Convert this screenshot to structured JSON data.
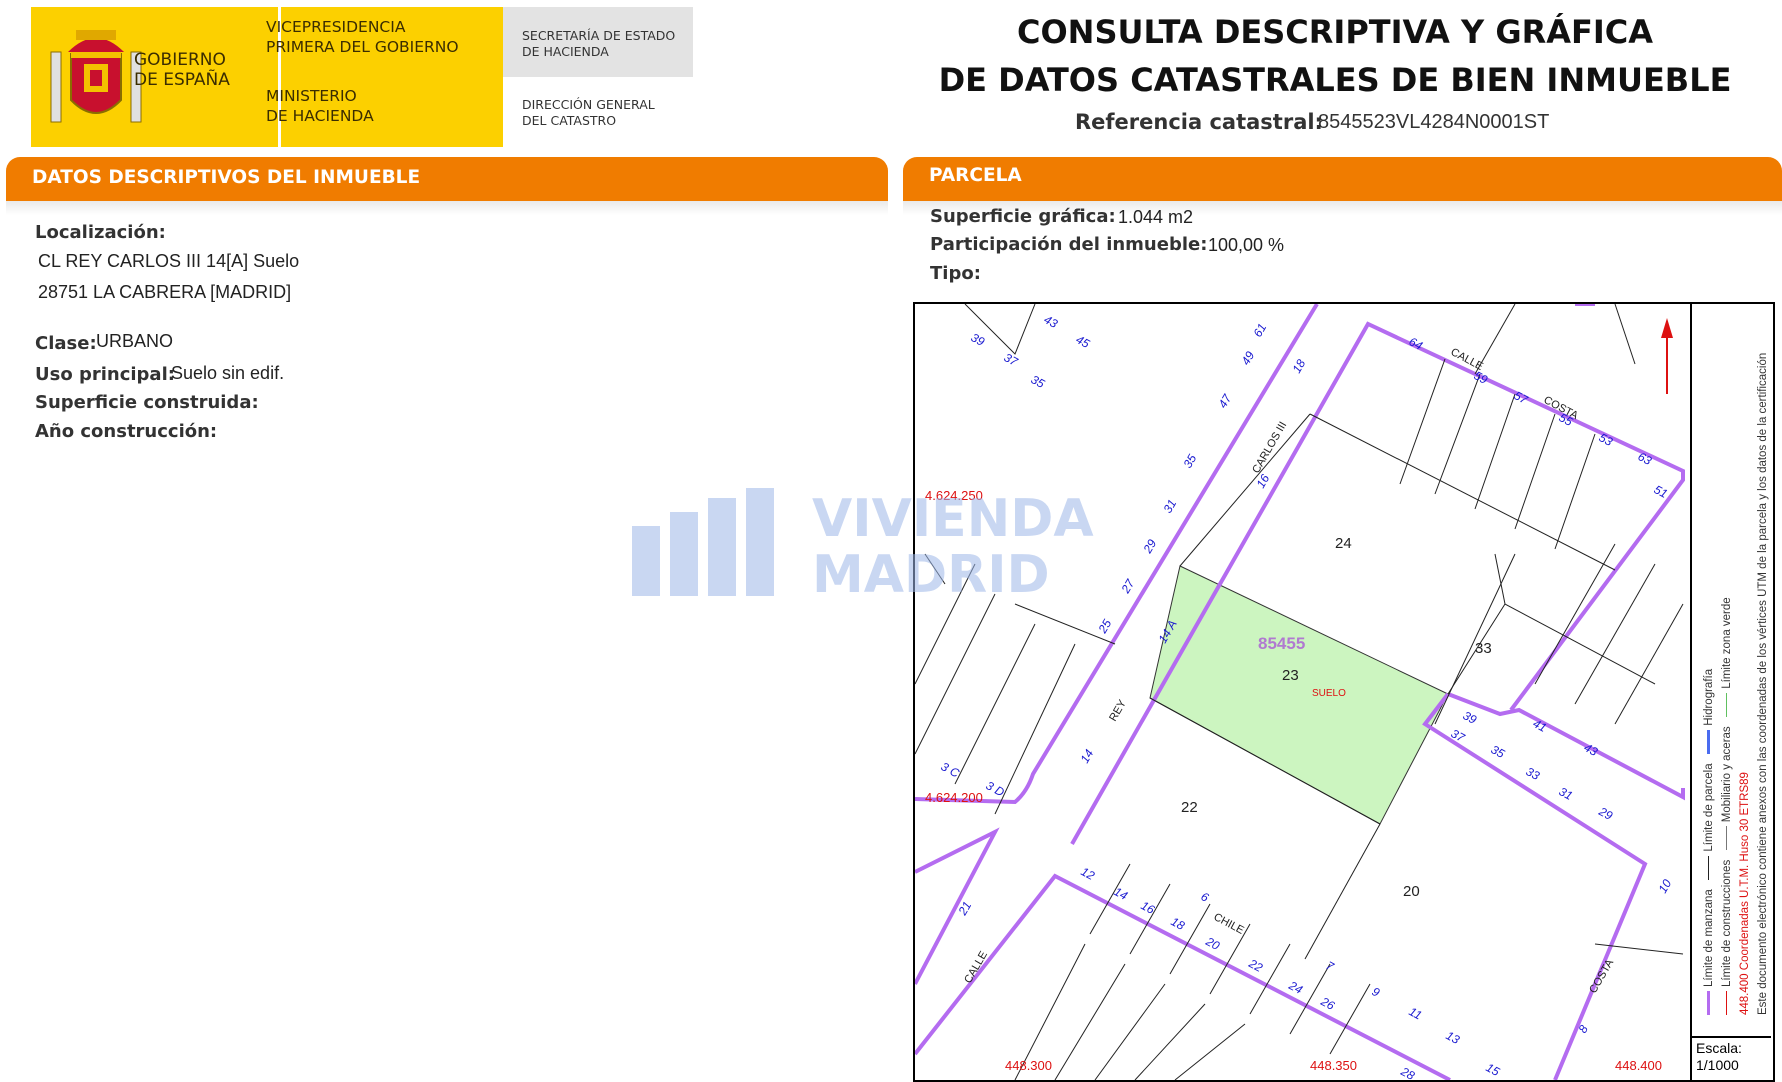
{
  "header": {
    "gobierno": [
      "GOBIERNO",
      "DE ESPAÑA"
    ],
    "vicepresidencia": [
      "VICEPRESIDENCIA",
      "PRIMERA DEL GOBIERNO"
    ],
    "ministerio": [
      "MINISTERIO",
      "DE HACIENDA"
    ],
    "secretaria": [
      "SECRETARÍA DE ESTADO",
      "DE HACIENDA"
    ],
    "direccion": [
      "DIRECCIÓN GENERAL",
      "DEL CATASTRO"
    ],
    "title_line1": "CONSULTA DESCRIPTIVA Y GRÁFICA",
    "title_line2": "DE DATOS CATASTRALES DE BIEN INMUEBLE",
    "ref_label": "Referencia catastral:",
    "ref_value": "8545523VL4284N0001ST"
  },
  "colors": {
    "brand_yellow": "#fcd000",
    "section_orange": "#f07c00",
    "parcel_green": "#ccf5c0",
    "boundary_purple": "#b46cf0",
    "street_number_blue": "#1a1ad0",
    "coordinate_red": "#d11"
  },
  "descriptivos": {
    "heading": "DATOS DESCRIPTIVOS DEL INMUEBLE",
    "localizacion_label": "Localización:",
    "address_line1": "CL REY CARLOS III 14[A] Suelo",
    "address_line2": "28751 LA CABRERA [MADRID]",
    "clase_label": "Clase:",
    "clase_value": "URBANO",
    "uso_label": "Uso principal:",
    "uso_value": "Suelo sin edif.",
    "superficie_label": "Superficie construida:",
    "anio_label": "Año construcción:"
  },
  "parcela": {
    "heading": "PARCELA",
    "superficie_label": "Superficie gráfica:",
    "superficie_value": "1.044 m2",
    "participacion_label": "Participación del inmueble:",
    "participacion_value": "100,00 %",
    "tipo_label": "Tipo:"
  },
  "map": {
    "coord_y_top": "4.624.250",
    "coord_y_bottom": "4.624.200",
    "coord_x": [
      "448.300",
      "448.350",
      "448.400"
    ],
    "parcel_ref": "85455",
    "parcel_labels": [
      "24",
      "33",
      "23",
      "22",
      "20"
    ],
    "suelo_label": "SUELO",
    "streets": [
      "CALLE",
      "COSTA",
      "CARLOS III",
      "REY",
      "CHILE",
      "COSTA",
      "CALLE"
    ],
    "street_numbers": [
      "39",
      "37",
      "35",
      "43",
      "45",
      "61",
      "49",
      "47",
      "35",
      "31",
      "29",
      "27",
      "25",
      "18",
      "16",
      "14 A",
      "14",
      "64",
      "59",
      "57",
      "55",
      "53",
      "63",
      "51",
      "39",
      "37",
      "35",
      "33",
      "31",
      "29",
      "41",
      "43",
      "12",
      "14",
      "16",
      "18",
      "20",
      "22",
      "24",
      "26",
      "28",
      "6",
      "7",
      "9",
      "11",
      "13",
      "15",
      "10",
      "8",
      "21",
      "3 C",
      "3 D"
    ]
  },
  "legend": {
    "line1": "Límite de manzana",
    "line2": "Límite de parcela",
    "line3": "Hidrografía",
    "line4": "Límite de construcciones",
    "line5": "Mobiliario y aceras",
    "line6": "Límite zona verde",
    "coords_note": "448.400 Coordenadas U.T.M. Huso 30 ETRS89",
    "doc_note": "Este documento electrónico contiene anexos con las coordenadas de los vértices UTM de la parcela y los datos de la certificación"
  },
  "escala": {
    "label": "Escala:",
    "value": "1/1000"
  },
  "watermark": {
    "line1": "VIVIENDA",
    "line2": "MADRID"
  }
}
